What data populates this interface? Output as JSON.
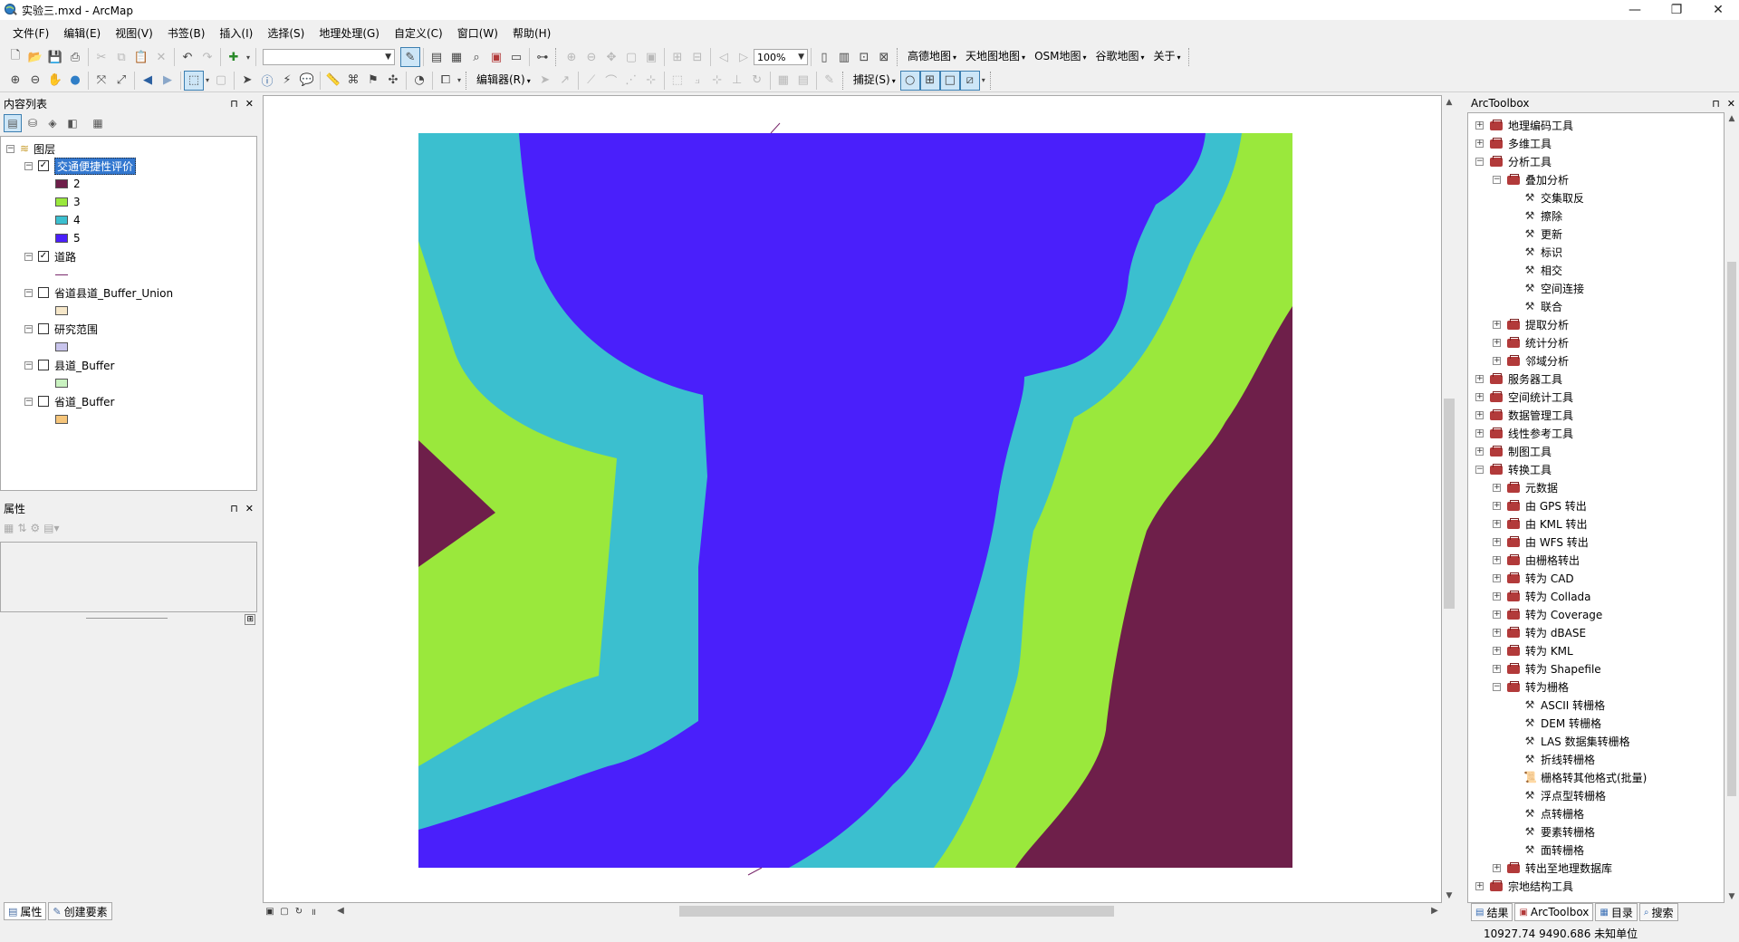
{
  "window": {
    "title": "实验三.mxd - ArcMap",
    "minimize": "—",
    "restore": "❐",
    "close": "✕"
  },
  "menu": [
    "文件(F)",
    "编辑(E)",
    "视图(V)",
    "书签(B)",
    "插入(I)",
    "选择(S)",
    "地理处理(G)",
    "自定义(C)",
    "窗口(W)",
    "帮助(H)"
  ],
  "toolbar1": {
    "scale_combo": "",
    "zoom_combo": "100%",
    "basemaps": [
      "高德地图",
      "天地图地图",
      "OSM地图",
      "谷歌地图",
      "关于"
    ]
  },
  "toolbar2": {
    "editor_menu": "编辑器(R)",
    "snapping_menu": "捕捉(S)"
  },
  "toc": {
    "title": "内容列表",
    "pin": "⊓",
    "close": "✕",
    "root": "图层",
    "layers": [
      {
        "name": "交通便捷性评价",
        "checked": true,
        "classes": [
          {
            "label": "2",
            "color": "#6e1f4a"
          },
          {
            "label": "3",
            "color": "#9ae83c"
          },
          {
            "label": "4",
            "color": "#3bbfcf"
          },
          {
            "label": "5",
            "color": "#4a1ffb"
          }
        ]
      },
      {
        "name": "道路",
        "checked": true,
        "symbol_color": "#7a2a6d"
      },
      {
        "name": "省道县道_Buffer_Union",
        "checked": false,
        "symbol_color": "#f6e7c9"
      },
      {
        "name": "研究范围",
        "checked": false,
        "symbol_color": "#c8c4ec"
      },
      {
        "name": "县道_Buffer",
        "checked": false,
        "symbol_color": "#c9f2c0"
      },
      {
        "name": "省道_Buffer",
        "checked": false,
        "symbol_color": "#f6c57a"
      }
    ]
  },
  "properties": {
    "title": "属性",
    "pin": "⊓",
    "close": "✕"
  },
  "left_tabs": [
    "属性",
    "创建要素"
  ],
  "arctoolbox": {
    "title": "ArcToolbox",
    "pin": "⊓",
    "close": "✕",
    "items": [
      {
        "label": "地理编码工具",
        "kind": "toolbox",
        "level": 0,
        "expand": "+"
      },
      {
        "label": "多维工具",
        "kind": "toolbox",
        "level": 0,
        "expand": "+"
      },
      {
        "label": "分析工具",
        "kind": "toolbox",
        "level": 0,
        "expand": "−"
      },
      {
        "label": "叠加分析",
        "kind": "toolbox",
        "level": 1,
        "expand": "−"
      },
      {
        "label": "交集取反",
        "kind": "tool",
        "level": 2
      },
      {
        "label": "擦除",
        "kind": "tool",
        "level": 2
      },
      {
        "label": "更新",
        "kind": "tool",
        "level": 2
      },
      {
        "label": "标识",
        "kind": "tool",
        "level": 2
      },
      {
        "label": "相交",
        "kind": "tool",
        "level": 2
      },
      {
        "label": "空间连接",
        "kind": "tool",
        "level": 2
      },
      {
        "label": "联合",
        "kind": "tool",
        "level": 2
      },
      {
        "label": "提取分析",
        "kind": "toolbox",
        "level": 1,
        "expand": "+"
      },
      {
        "label": "统计分析",
        "kind": "toolbox",
        "level": 1,
        "expand": "+"
      },
      {
        "label": "邻域分析",
        "kind": "toolbox",
        "level": 1,
        "expand": "+"
      },
      {
        "label": "服务器工具",
        "kind": "toolbox",
        "level": 0,
        "expand": "+"
      },
      {
        "label": "空间统计工具",
        "kind": "toolbox",
        "level": 0,
        "expand": "+"
      },
      {
        "label": "数据管理工具",
        "kind": "toolbox",
        "level": 0,
        "expand": "+"
      },
      {
        "label": "线性参考工具",
        "kind": "toolbox",
        "level": 0,
        "expand": "+"
      },
      {
        "label": "制图工具",
        "kind": "toolbox",
        "level": 0,
        "expand": "+"
      },
      {
        "label": "转换工具",
        "kind": "toolbox",
        "level": 0,
        "expand": "−"
      },
      {
        "label": "元数据",
        "kind": "toolbox",
        "level": 1,
        "expand": "+"
      },
      {
        "label": "由 GPS 转出",
        "kind": "toolbox",
        "level": 1,
        "expand": "+"
      },
      {
        "label": "由 KML 转出",
        "kind": "toolbox",
        "level": 1,
        "expand": "+"
      },
      {
        "label": "由 WFS 转出",
        "kind": "toolbox",
        "level": 1,
        "expand": "+"
      },
      {
        "label": "由栅格转出",
        "kind": "toolbox",
        "level": 1,
        "expand": "+"
      },
      {
        "label": "转为 CAD",
        "kind": "toolbox",
        "level": 1,
        "expand": "+"
      },
      {
        "label": "转为 Collada",
        "kind": "toolbox",
        "level": 1,
        "expand": "+"
      },
      {
        "label": "转为 Coverage",
        "kind": "toolbox",
        "level": 1,
        "expand": "+"
      },
      {
        "label": "转为 dBASE",
        "kind": "toolbox",
        "level": 1,
        "expand": "+"
      },
      {
        "label": "转为 KML",
        "kind": "toolbox",
        "level": 1,
        "expand": "+"
      },
      {
        "label": "转为 Shapefile",
        "kind": "toolbox",
        "level": 1,
        "expand": "+"
      },
      {
        "label": "转为栅格",
        "kind": "toolbox",
        "level": 1,
        "expand": "−"
      },
      {
        "label": "ASCII 转栅格",
        "kind": "tool",
        "level": 2
      },
      {
        "label": "DEM 转栅格",
        "kind": "tool",
        "level": 2
      },
      {
        "label": "LAS 数据集转栅格",
        "kind": "tool",
        "level": 2
      },
      {
        "label": "折线转栅格",
        "kind": "tool",
        "level": 2
      },
      {
        "label": "栅格转其他格式(批量)",
        "kind": "script",
        "level": 2
      },
      {
        "label": "浮点型转栅格",
        "kind": "tool",
        "level": 2
      },
      {
        "label": "点转栅格",
        "kind": "tool",
        "level": 2
      },
      {
        "label": "要素转栅格",
        "kind": "tool",
        "level": 2
      },
      {
        "label": "面转栅格",
        "kind": "tool",
        "level": 2
      },
      {
        "label": "转出至地理数据库",
        "kind": "toolbox",
        "level": 1,
        "expand": "+"
      },
      {
        "label": "宗地结构工具",
        "kind": "toolbox",
        "level": 0,
        "expand": "+"
      }
    ]
  },
  "right_tabs": [
    "结果",
    "ArcToolbox",
    "目录",
    "搜索"
  ],
  "status": {
    "coordinates": "10927.74  9490.686 未知单位"
  },
  "map": {
    "colors": {
      "class2": "#6e1f4a",
      "class3": "#9ae83c",
      "class4": "#3bbfcf",
      "class5": "#4a1ffb",
      "road": "#7a2a6d"
    }
  }
}
